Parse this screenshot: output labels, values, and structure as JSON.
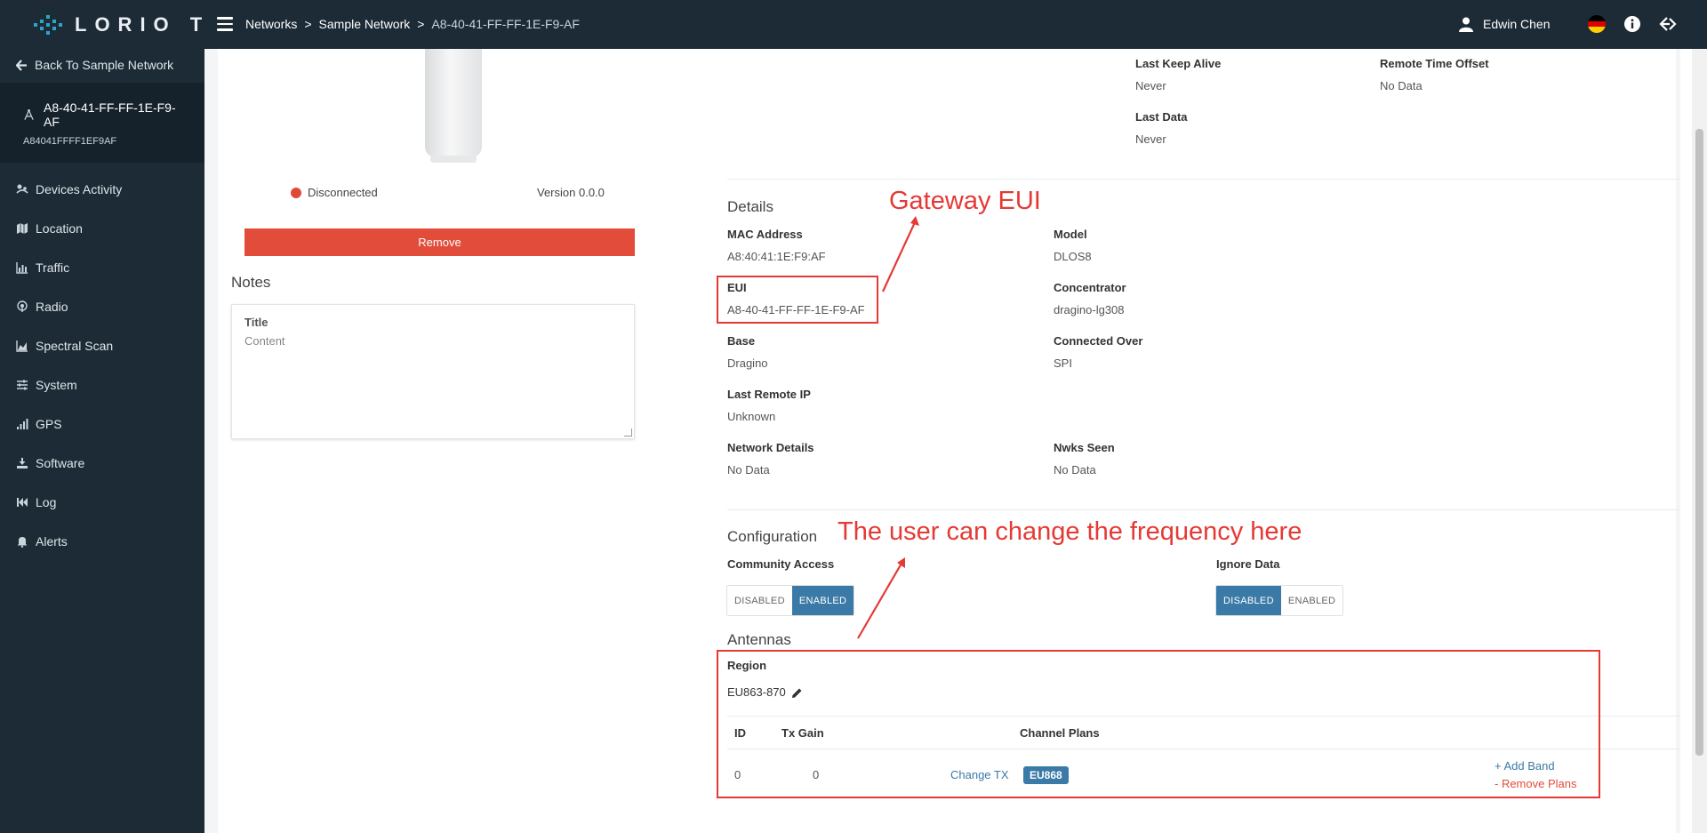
{
  "brand": {
    "name": "LORIO T"
  },
  "breadcrumb": {
    "items": [
      "Networks",
      "Sample Network"
    ],
    "current": "A8-40-41-FF-FF-1E-F9-AF",
    "separator": ">"
  },
  "user": {
    "name": "Edwin Chen"
  },
  "language": {
    "flag_colors": [
      "#000000",
      "#dd0000",
      "#ffce00"
    ]
  },
  "sidebar": {
    "back_label": "Back To Sample Network",
    "gateway_name": "A8-40-41-FF-FF-1E-F9-AF",
    "gateway_sub": "A84041FFFF1EF9AF",
    "items": [
      {
        "label": "Devices Activity",
        "icon": "activity-icon"
      },
      {
        "label": "Location",
        "icon": "map-icon"
      },
      {
        "label": "Traffic",
        "icon": "bar-chart-icon"
      },
      {
        "label": "Radio",
        "icon": "radio-icon"
      },
      {
        "label": "Spectral Scan",
        "icon": "area-chart-icon"
      },
      {
        "label": "System",
        "icon": "sliders-icon"
      },
      {
        "label": "GPS",
        "icon": "signal-icon"
      },
      {
        "label": "Software",
        "icon": "download-icon"
      },
      {
        "label": "Log",
        "icon": "rewind-icon"
      },
      {
        "label": "Alerts",
        "icon": "bell-icon"
      }
    ]
  },
  "device": {
    "status": "Disconnected",
    "status_color": "#e0493a",
    "version": "Version 0.0.0",
    "remove_label": "Remove"
  },
  "notes": {
    "heading": "Notes",
    "title": "Title",
    "content": "Content"
  },
  "status_info": {
    "last_keep_alive_label": "Last Keep Alive",
    "last_keep_alive": "Never",
    "remote_time_offset_label": "Remote Time Offset",
    "remote_time_offset": "No Data",
    "last_data_label": "Last Data",
    "last_data": "Never"
  },
  "details": {
    "heading": "Details",
    "mac_label": "MAC Address",
    "mac": "A8:40:41:1E:F9:AF",
    "model_label": "Model",
    "model": "DLOS8",
    "eui_label": "EUI",
    "eui": "A8-40-41-FF-FF-1E-F9-AF",
    "concentrator_label": "Concentrator",
    "concentrator": "dragino-lg308",
    "base_label": "Base",
    "base": "Dragino",
    "connected_over_label": "Connected Over",
    "connected_over": "SPI",
    "last_remote_ip_label": "Last Remote IP",
    "last_remote_ip": "Unknown",
    "network_details_label": "Network Details",
    "network_details": "No Data",
    "nwks_seen_label": "Nwks Seen",
    "nwks_seen": "No Data"
  },
  "configuration": {
    "heading": "Configuration",
    "community_access_label": "Community Access",
    "community_access_options": [
      "DISABLED",
      "ENABLED"
    ],
    "community_access_selected": "ENABLED",
    "ignore_data_label": "Ignore Data",
    "ignore_data_options": [
      "DISABLED",
      "ENABLED"
    ],
    "ignore_data_selected": "DISABLED"
  },
  "antennas": {
    "heading": "Antennas",
    "region_label": "Region",
    "region": "EU863-870",
    "columns": [
      "ID",
      "Tx Gain",
      "Channel Plans"
    ],
    "rows": [
      {
        "id": "0",
        "tx_gain": "0",
        "change_tx": "Change TX",
        "plan": "EU868"
      }
    ],
    "add_band": "+ Add Band",
    "remove_plans": "- Remove Plans"
  },
  "annotations": {
    "eui_note": "Gateway EUI",
    "frequency_note": "The user can change the frequency here",
    "color": "#e53935"
  }
}
